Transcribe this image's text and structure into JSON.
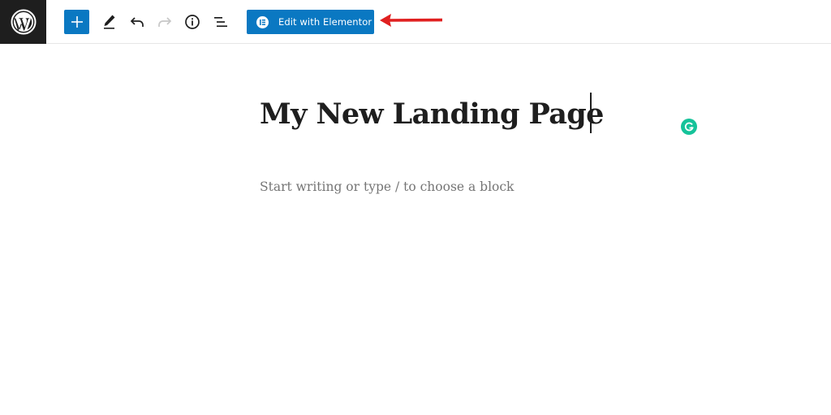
{
  "toolbar": {
    "logo_icon": "wordpress-logo-icon",
    "add_block_icon": "plus-icon",
    "tools_icon": "pencil-icon",
    "undo_icon": "undo-icon",
    "redo_icon": "redo-icon",
    "details_icon": "info-icon",
    "outline_icon": "list-view-icon",
    "elementor_button_label": "Edit with Elementor",
    "elementor_icon": "elementor-icon",
    "accent_color": "#0a78c2",
    "logo_bg_color": "#1e1e1e"
  },
  "annotation": {
    "arrow_color": "#e02020",
    "arrow_icon": "red-arrow-icon"
  },
  "editor": {
    "title": "My New Landing Page",
    "placeholder": "Start writing or type / to choose a block",
    "grammarly_icon": "grammarly-icon",
    "grammarly_color": "#15c39a"
  }
}
